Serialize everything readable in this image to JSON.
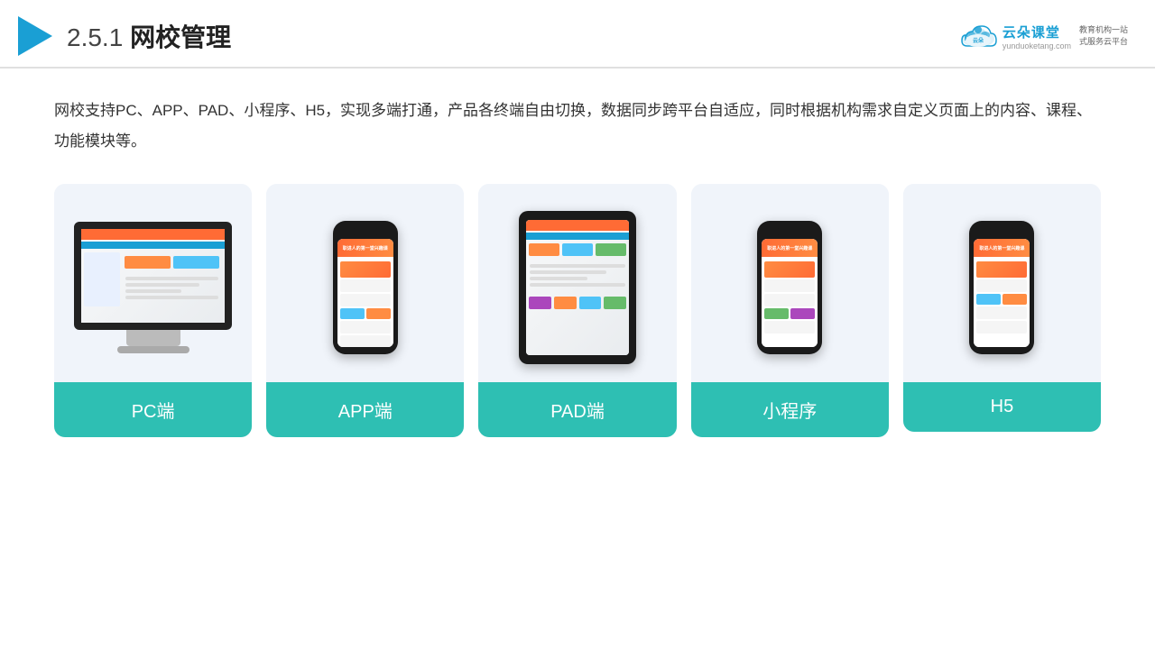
{
  "header": {
    "title": "网校管理",
    "title_prefix": "2.5.1",
    "logo": {
      "name": "云朵课堂",
      "domain": "yunduoketang.com",
      "slogan": "教育机构一站\n式服务云平台"
    }
  },
  "description": "网校支持PC、APP、PAD、小程序、H5，实现多端打通，产品各终端自由切换，数据同步跨平台自适应，同时根据机构需求自定义页面上的内容、课程、功能模块等。",
  "cards": [
    {
      "label": "PC端",
      "type": "pc"
    },
    {
      "label": "APP端",
      "type": "phone"
    },
    {
      "label": "PAD端",
      "type": "tablet"
    },
    {
      "label": "小程序",
      "type": "phone"
    },
    {
      "label": "H5",
      "type": "phone"
    }
  ],
  "accent_color": "#2ebfb3"
}
